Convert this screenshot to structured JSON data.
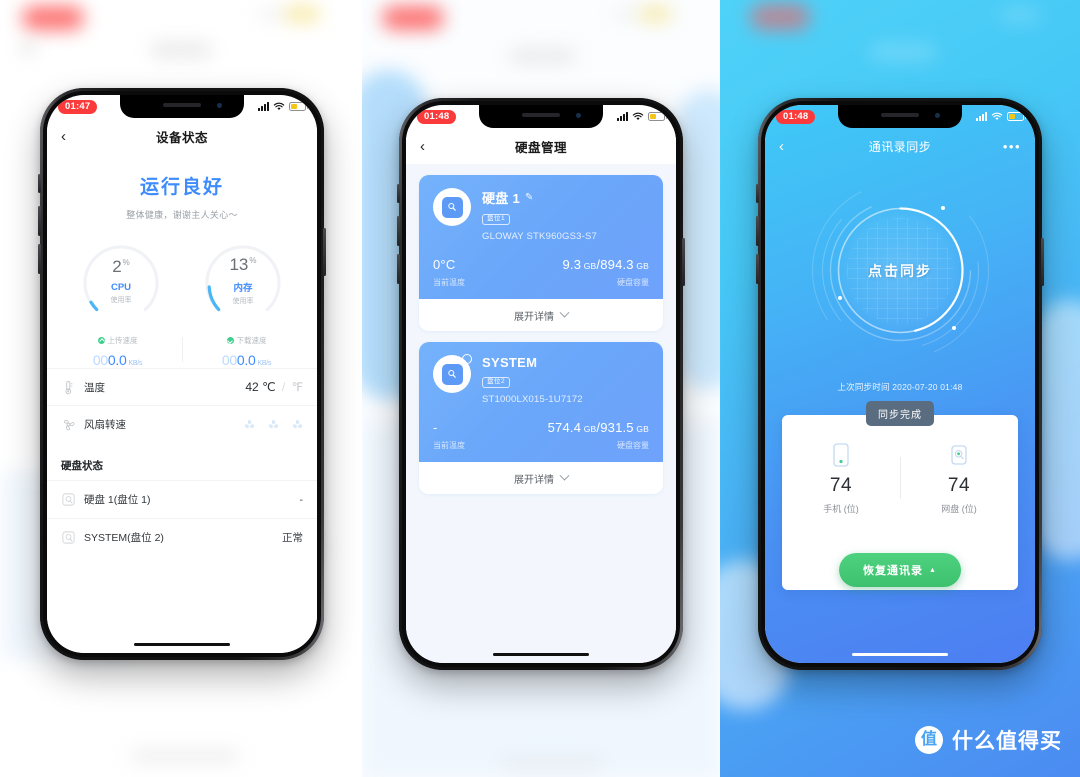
{
  "watermark": {
    "logo_char": "值",
    "text": "什么值得买"
  },
  "phone1": {
    "status": {
      "time": "01:47",
      "signal_icon": "signal-bars-icon",
      "wifi_icon": "wifi-icon",
      "battery_icon": "battery-low-power-icon"
    },
    "nav": {
      "back_icon": "back-chevron-icon",
      "title": "设备状态"
    },
    "hero": {
      "title": "运行良好",
      "subtitle": "整体健康，谢谢主人关心～"
    },
    "gauges": [
      {
        "value": "2",
        "unit": "%",
        "name": "CPU",
        "caption": "使用率",
        "percent": 2
      },
      {
        "value": "13",
        "unit": "%",
        "name": "内存",
        "caption": "使用率",
        "percent": 13
      }
    ],
    "speeds": [
      {
        "icon": "upload-arrow-icon",
        "label": "上传速度",
        "zeros": "00",
        "value": "0.0",
        "unit": "KB/s"
      },
      {
        "icon": "download-arrow-icon",
        "label": "下载速度",
        "zeros": "00",
        "value": "0.0",
        "unit": "KB/s"
      }
    ],
    "temperature": {
      "icon": "thermometer-icon",
      "label": "温度",
      "value": "42",
      "unit_active": "℃",
      "separator": "/",
      "unit_inactive": "℉"
    },
    "fan": {
      "icon": "fan-icon",
      "label": "风扇转速",
      "levels_icon": "fan-level-icon",
      "levels": 3
    },
    "disk_section_title": "硬盘状态",
    "disks": [
      {
        "icon": "hard-disk-icon",
        "label": "硬盘 1(盘位 1)",
        "status": "-"
      },
      {
        "icon": "hard-disk-icon",
        "label": "SYSTEM(盘位 2)",
        "status": "正常"
      }
    ]
  },
  "phone2": {
    "status": {
      "time": "01:48"
    },
    "nav": {
      "back_icon": "back-chevron-icon",
      "title": "硬盘管理"
    },
    "disks": [
      {
        "icon": "hard-disk-icon",
        "name": "硬盘 1",
        "edit_icon": "edit-pencil-icon",
        "slot_badge": "盘位1",
        "model": "GLOWAY STK960GS3-S7",
        "temp_value": "0°C",
        "temp_label": "当前温度",
        "capacity_used": "9.3",
        "capacity_used_unit": "GB",
        "capacity_total": "894.3",
        "capacity_total_unit": "GB",
        "capacity_label": "硬盘容量",
        "expand_label": "展开详情",
        "expand_icon": "chevron-down-icon",
        "is_system": false
      },
      {
        "icon": "hard-disk-icon",
        "name": "SYSTEM",
        "edit_icon": "",
        "slot_badge": "盘位2",
        "model": "ST1000LX015-1U7172",
        "temp_value": "-",
        "temp_label": "当前温度",
        "capacity_used": "574.4",
        "capacity_used_unit": "GB",
        "capacity_total": "931.5",
        "capacity_total_unit": "GB",
        "capacity_label": "硬盘容量",
        "expand_label": "展开详情",
        "expand_icon": "chevron-down-icon",
        "is_system": true
      }
    ]
  },
  "phone3": {
    "status": {
      "time": "01:48"
    },
    "nav": {
      "back_icon": "back-chevron-icon",
      "title": "通讯录同步",
      "more_icon": "more-dots-icon",
      "more_glyph": "•••"
    },
    "sync_button_label": "点击同步",
    "last_sync": "上次同步时间 2020-07-20 01:48",
    "toast": "同步完成",
    "stats": [
      {
        "icon": "phone-device-icon",
        "count": "74",
        "label": "手机 (位)"
      },
      {
        "icon": "cloud-disk-icon",
        "count": "74",
        "label": "网盘 (位)"
      }
    ],
    "restore_button": {
      "label": "恢复通讯录",
      "arrow_icon": "caret-up-icon",
      "arrow_glyph": "▲"
    }
  },
  "colors": {
    "accent_blue": "#3d8bfd",
    "card_blue": "#6aa6fa",
    "green": "#3ecf8e",
    "restore_green": "#4ed27f",
    "time_red": "#fb3b3b",
    "toast_grey": "#5a6c80"
  }
}
